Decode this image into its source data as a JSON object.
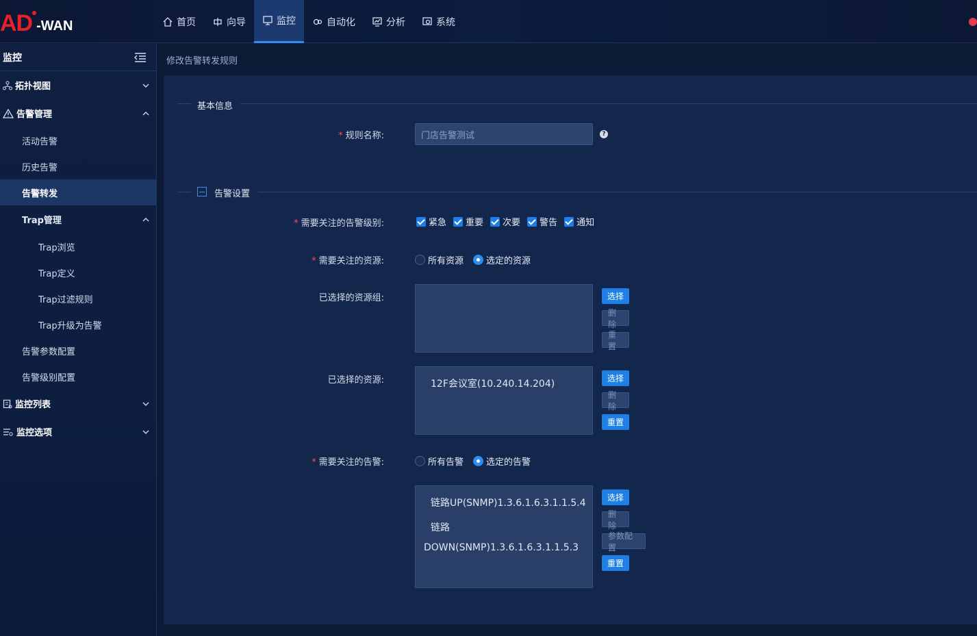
{
  "header": {
    "logo_main": "AD",
    "logo_sub": "-WAN",
    "nav": [
      {
        "label": "首页",
        "icon": "home-icon"
      },
      {
        "label": "向导",
        "icon": "wizard-icon"
      },
      {
        "label": "监控",
        "icon": "monitor-icon",
        "active": true
      },
      {
        "label": "自动化",
        "icon": "automation-icon"
      },
      {
        "label": "分析",
        "icon": "analysis-icon"
      },
      {
        "label": "系统",
        "icon": "system-icon"
      }
    ]
  },
  "sidebar": {
    "title": "监控",
    "topology": "拓扑视图",
    "alarm_mgmt": "告警管理",
    "active_alarm": "活动告警",
    "history_alarm": "历史告警",
    "alarm_forward": "告警转发",
    "trap_mgmt": "Trap管理",
    "trap_browse": "Trap浏览",
    "trap_define": "Trap定义",
    "trap_filter": "Trap过滤规则",
    "trap_upgrade": "Trap升级为告警",
    "alarm_param": "告警参数配置",
    "alarm_level": "告警级别配置",
    "monitor_list": "监控列表",
    "monitor_options": "监控选项"
  },
  "breadcrumb": "修改告警转发规则",
  "form": {
    "basic_section": "基本信息",
    "rule_name_label": "规则名称:",
    "rule_name_value": "门店告警测试",
    "alarm_section": "告警设置",
    "levels_label": "需要关注的告警级别:",
    "levels": [
      "紧急",
      "重要",
      "次要",
      "警告",
      "通知"
    ],
    "resource_label": "需要关注的资源:",
    "resource_all": "所有资源",
    "resource_selected": "选定的资源",
    "resource_group_label": "已选择的资源组:",
    "resources_label": "已选择的资源:",
    "resources": [
      "12F会议室(10.240.14.204)"
    ],
    "alarms_label": "需要关注的告警:",
    "alarms_all": "所有告警",
    "alarms_selected": "选定的告警",
    "alarms": [
      "链路UP(SNMP)1.3.6.1.6.3.1.1.5.4",
      "链路",
      "DOWN(SNMP)1.3.6.1.6.3.1.1.5.3"
    ],
    "btn_select": "选择",
    "btn_delete": "删除",
    "btn_reset": "重置",
    "btn_param": "参数配置"
  }
}
